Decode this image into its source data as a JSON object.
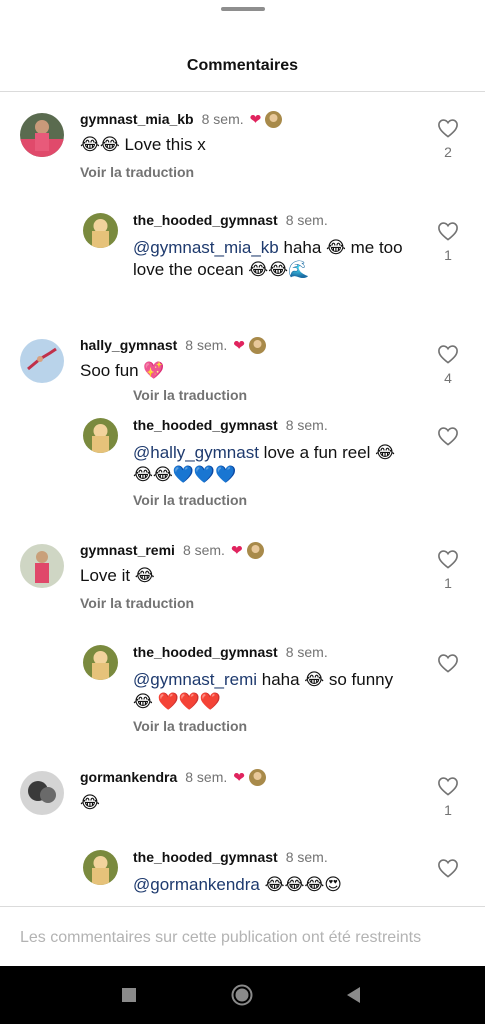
{
  "header": {
    "title": "Commentaires"
  },
  "icons": {
    "like": "heart-outline-icon",
    "creator_liked": "red-heart-icon",
    "nav_recents": "square-icon",
    "nav_home": "circle-icon",
    "nav_back": "triangle-back-icon"
  },
  "colors": {
    "mention": "#1e3a6e",
    "secondary_text": "#737373",
    "liked_heart": "#e0245e",
    "divider": "#dbdbdb",
    "nav_bar": "#000000"
  },
  "comments": [
    {
      "kind": "top",
      "username": "gymnast_mia_kb",
      "time": "8 sem.",
      "creator_liked": true,
      "mention": "",
      "text_lines": [
        "😂😂 Love this x"
      ],
      "translate": "Voir la traduction",
      "likes": "2"
    },
    {
      "kind": "reply",
      "username": "the_hooded_gymnast",
      "time": "8 sem.",
      "creator_liked": false,
      "mention": "@gymnast_mia_kb",
      "text_lines": [
        " haha 😂 me too",
        "love the ocean 😂😂🌊"
      ],
      "translate": "Voir la traduction",
      "likes": "1"
    },
    {
      "kind": "top",
      "username": "hally_gymnast",
      "time": "8 sem.",
      "creator_liked": true,
      "mention": "",
      "text_lines": [
        "Soo fun 💖"
      ],
      "translate": "",
      "likes": "4"
    },
    {
      "kind": "reply",
      "username": "the_hooded_gymnast",
      "time": "8 sem.",
      "creator_liked": false,
      "mention": "@hally_gymnast",
      "text_lines": [
        " love a fun reel 😂",
        "😂😂💙💙💙"
      ],
      "translate": "Voir la traduction",
      "likes": ""
    },
    {
      "kind": "top",
      "username": "gymnast_remi",
      "time": "8 sem.",
      "creator_liked": true,
      "mention": "",
      "text_lines": [
        "Love it 😂"
      ],
      "translate": "Voir la traduction",
      "likes": "1"
    },
    {
      "kind": "reply",
      "username": "the_hooded_gymnast",
      "time": "8 sem.",
      "creator_liked": false,
      "mention": "@gymnast_remi",
      "text_lines": [
        " haha 😂 so funny",
        "😂 ❤️❤️❤️"
      ],
      "translate": "Voir la traduction",
      "likes": ""
    },
    {
      "kind": "top",
      "username": "gormankendra",
      "time": "8 sem.",
      "creator_liked": true,
      "mention": "",
      "text_lines": [
        "😂"
      ],
      "translate": "",
      "likes": "1"
    },
    {
      "kind": "reply",
      "username": "the_hooded_gymnast",
      "time": "8 sem.",
      "creator_liked": false,
      "mention": "@gormankendra",
      "text_lines": [
        " 😂😂😂😍"
      ],
      "translate": "",
      "likes": ""
    }
  ],
  "footer": {
    "text": "Les commentaires sur cette publication ont été restreints"
  }
}
